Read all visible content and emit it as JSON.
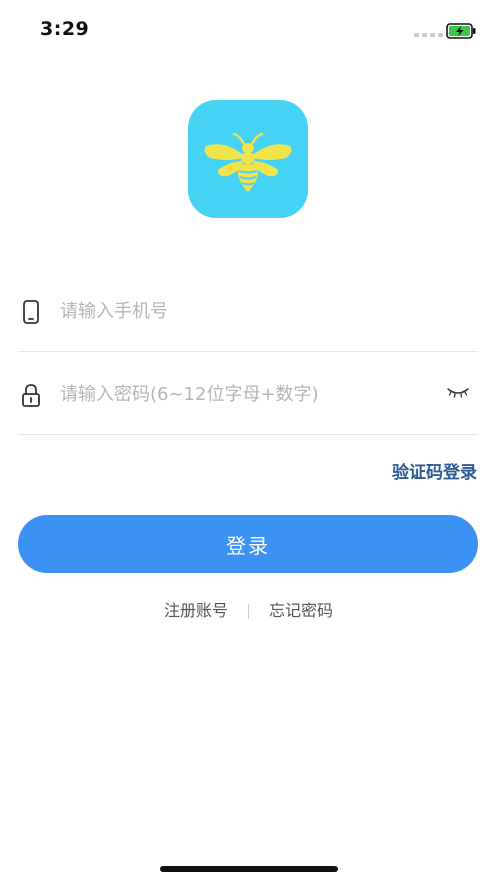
{
  "status_bar": {
    "time": "3:29",
    "battery_icon": "battery-charging-icon",
    "signal_icon": "signal-dots-icon"
  },
  "logo": {
    "icon": "bee-icon",
    "background_color": "#46d2f4",
    "bee_color": "#f1e34b"
  },
  "form": {
    "phone": {
      "icon": "mobile-phone-icon",
      "placeholder": "请输入手机号",
      "value": ""
    },
    "password": {
      "icon": "lock-icon",
      "placeholder": "请输入密码(6~12位字母+数字)",
      "value": "",
      "toggle_icon": "eye-closed-icon"
    }
  },
  "sms_login_link": "验证码登录",
  "login_button": "登录",
  "bottom_links": {
    "register": "注册账号",
    "forgot_password": "忘记密码"
  },
  "colors": {
    "primary": "#3b92f4",
    "link": "#2d5a94",
    "battery": "#3cc84a"
  }
}
